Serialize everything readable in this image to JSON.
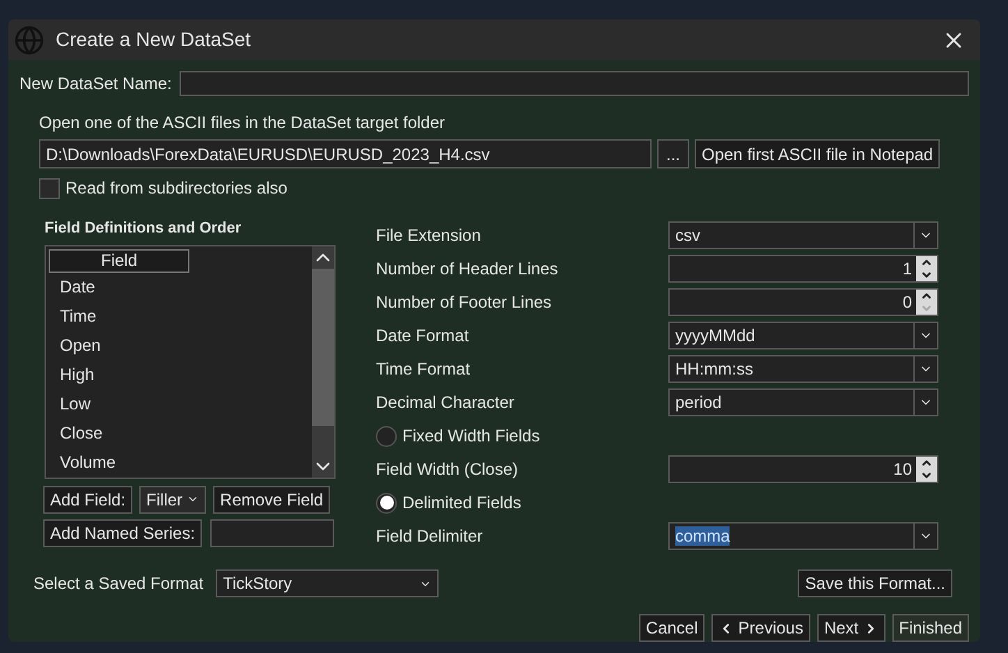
{
  "window": {
    "title": "Create a New DataSet"
  },
  "name_field": {
    "label": "New DataSet Name:"
  },
  "source": {
    "label": "Open one of the ASCII files in the DataSet target folder",
    "path": "D:\\Downloads\\ForexData\\EURUSD\\EURUSD_2023_H4.csv",
    "browse_button": "...",
    "notepad_button": "Open first ASCII file in Notepad",
    "subdirectories": {
      "label": "Read from subdirectories also",
      "checked": false
    }
  },
  "fields": {
    "heading": "Field Definitions and Order",
    "column": "Field",
    "items": [
      "Date",
      "Time",
      "Open",
      "High",
      "Low",
      "Close",
      "Volume"
    ],
    "add_field_button": "Add Field:",
    "field_type": "Filler",
    "remove_button": "Remove Field",
    "add_named_button": "Add Named Series:"
  },
  "settings": [
    {
      "kind": "select",
      "label": "File Extension",
      "value": "csv",
      "highlighted": false
    },
    {
      "kind": "spinner",
      "label": "Number of Header Lines",
      "value": "1",
      "down_disabled": false
    },
    {
      "kind": "spinner",
      "label": "Number of Footer Lines",
      "value": "0",
      "down_disabled": true
    },
    {
      "kind": "select",
      "label": "Date Format",
      "value": "yyyyMMdd",
      "highlighted": false
    },
    {
      "kind": "select",
      "label": "Time Format",
      "value": "HH:mm:ss",
      "highlighted": false
    },
    {
      "kind": "select",
      "label": "Decimal Character",
      "value": "period",
      "highlighted": false
    },
    {
      "kind": "radio",
      "label": "Fixed Width Fields",
      "selected": false
    },
    {
      "kind": "spinner",
      "label": "Field Width (Close)",
      "value": "10",
      "down_disabled": false
    },
    {
      "kind": "radio",
      "label": "Delimited Fields",
      "selected": true
    },
    {
      "kind": "select",
      "label": "Field Delimiter",
      "value": "comma",
      "highlighted": true
    }
  ],
  "saved_format": {
    "label": "Select a Saved Format",
    "value": "TickStory"
  },
  "save_format_button": "Save this Format...",
  "footer_buttons": [
    {
      "label": "Cancel",
      "disabled": false,
      "kind": "plain"
    },
    {
      "label": "Previous",
      "disabled": false,
      "kind": "back"
    },
    {
      "label": "Next",
      "disabled": false,
      "kind": "forward"
    },
    {
      "label": "Finished",
      "disabled": true,
      "kind": "plain"
    }
  ]
}
